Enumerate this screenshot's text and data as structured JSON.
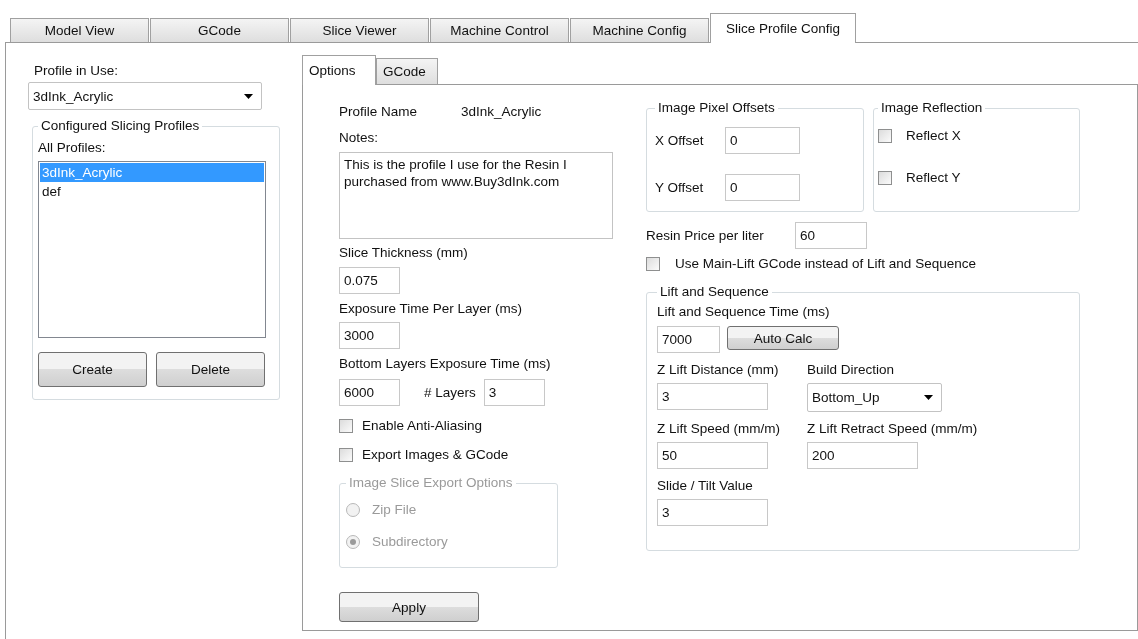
{
  "tabs": [
    {
      "label": "Model View",
      "selected": false
    },
    {
      "label": "GCode",
      "selected": false
    },
    {
      "label": "Slice Viewer",
      "selected": false
    },
    {
      "label": "Machine Control",
      "selected": false
    },
    {
      "label": "Machine Config",
      "selected": false
    },
    {
      "label": "Slice Profile Config",
      "selected": true
    }
  ],
  "profile_in_use": {
    "label": "Profile in Use:",
    "value": "3dInk_Acrylic"
  },
  "profiles_group": {
    "title": "Configured Slicing Profiles",
    "list_label": "All Profiles:",
    "items": [
      {
        "label": "3dInk_Acrylic",
        "selected": true
      },
      {
        "label": "def",
        "selected": false
      }
    ],
    "buttons": [
      "Create",
      "Delete"
    ]
  },
  "subtabs": [
    {
      "label": "Options",
      "selected": true
    },
    {
      "label": "GCode",
      "selected": false
    }
  ],
  "options": {
    "profile_name": {
      "label": "Profile Name",
      "value": "3dInk_Acrylic"
    },
    "notes": {
      "label": "Notes:",
      "value": "This is the profile I use for the Resin I\npurchased from www.Buy3dInk.com"
    },
    "slice_thickness": {
      "label": "Slice Thickness (mm)",
      "value": "0.075"
    },
    "exposure_time": {
      "label": "Exposure Time Per Layer (ms)",
      "value": "3000"
    },
    "bottom_layers": {
      "label": "Bottom Layers Exposure Time (ms)",
      "value": "6000",
      "layers_label": "# Layers",
      "layers_value": "3"
    },
    "checkboxes": [
      {
        "label": "Enable Anti-Aliasing",
        "checked": false
      },
      {
        "label": "Export Images & GCode",
        "checked": false
      }
    ],
    "export_options": {
      "title": "Image Slice Export Options",
      "disabled": true,
      "options": [
        {
          "label": "Zip File",
          "selected": false
        },
        {
          "label": "Subdirectory",
          "selected": true
        }
      ]
    },
    "apply_button": "Apply",
    "pixel_offsets": {
      "title": "Image Pixel Offsets",
      "fields": [
        {
          "label": "X Offset",
          "value": "0"
        },
        {
          "label": "Y Offset",
          "value": "0"
        }
      ]
    },
    "reflection": {
      "title": "Image Reflection",
      "checkboxes": [
        {
          "label": "Reflect X",
          "checked": false
        },
        {
          "label": "Reflect Y",
          "checked": false
        }
      ]
    },
    "resin_price": {
      "label": "Resin Price per liter",
      "value": "60"
    },
    "use_main_lift": {
      "label": "Use Main-Lift GCode instead of Lift and Sequence",
      "checked": false
    },
    "lift_sequence": {
      "title": "Lift and Sequence",
      "time": {
        "label": "Lift and Sequence Time (ms)",
        "value": "7000"
      },
      "auto_calc_button": "Auto Calc",
      "z_lift_distance": {
        "label": "Z Lift Distance (mm)",
        "value": "3"
      },
      "build_direction": {
        "label": "Build Direction",
        "value": "Bottom_Up"
      },
      "z_lift_speed": {
        "label": "Z Lift Speed (mm/m)",
        "value": "50"
      },
      "z_lift_retract_speed": {
        "label": "Z Lift Retract Speed (mm/m)",
        "value": "200"
      },
      "slide_tilt": {
        "label": "Slide / Tilt Value",
        "value": "3"
      }
    }
  }
}
